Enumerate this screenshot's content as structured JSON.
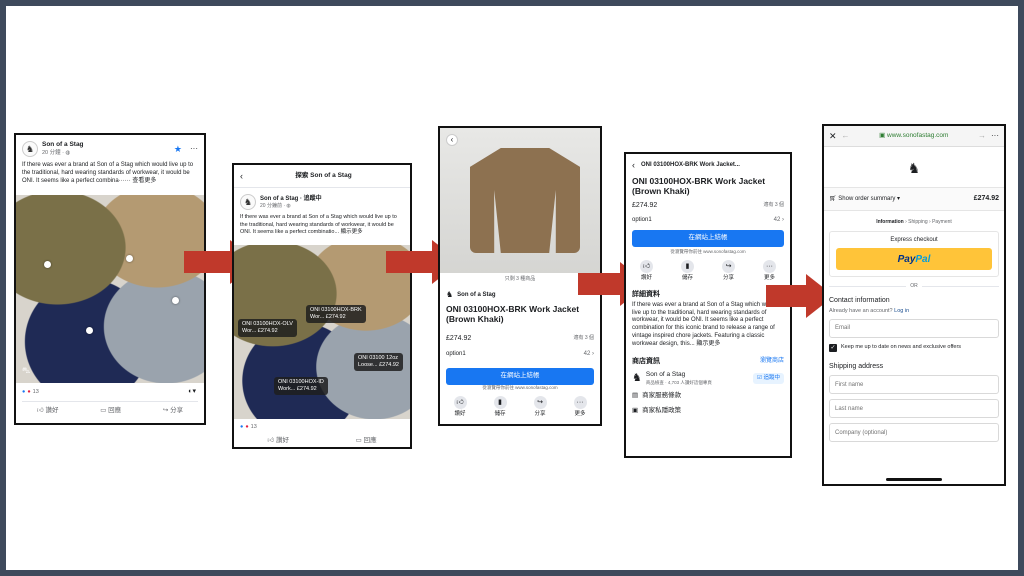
{
  "brand": "Son of a Stag",
  "post_text": "If there was ever a brand at Son of a Stag which would live up to the traditional, hard wearing standards of workwear, it would be ONI. It seems like a perfect combina······ 查看更多",
  "screen1": {
    "name": "Son of a Stag",
    "time": "20 分鐘 · ",
    "reaction_count": "13",
    "like": "讚好",
    "comment": "回應",
    "share": "分享"
  },
  "screen2": {
    "header": "探索 Son of a Stag",
    "name": "Son of a Stag · 追蹤中",
    "time": "20 分鐘前 · ",
    "text": "If there was ever a brand at Son of a Stag which would live up to the traditional, hard wearing standards of workwear, it would be ONI. It seems like a perfect combinatio... 顯示更多",
    "tags": [
      {
        "line1": "ONI 03100HOX-OLV",
        "line2": "Wor... £274.92"
      },
      {
        "line1": "ONI 03100HOX-BRK",
        "line2": "Wor... £274.92"
      },
      {
        "line1": "ONI 03100 12oz",
        "line2": "Loose... £274.92"
      },
      {
        "line1": "ONI 03100HOX-ID",
        "line2": "Work... £274.92"
      }
    ],
    "reaction_count": "13",
    "like": "讚好",
    "comment": "回應"
  },
  "screen3": {
    "caption": "只剩 3 種商品",
    "brand": "Son of a Stag",
    "title": "ONI 03100HOX-BRK Work Jacket (Brown Khaki)",
    "price": "£274.92",
    "shipping": "適有 3 個",
    "option": "option1",
    "option_count": "42",
    "cta": "在網站上結帳",
    "domain_note": "從瀏覽帶你前往 www.sonofastag.com",
    "actions": [
      "讚好",
      "儲存",
      "分享",
      "更多"
    ]
  },
  "screen4": {
    "header": "ONI 03100HOX-BRK Work Jacket...",
    "title": "ONI 03100HOX-BRK Work Jacket (Brown Khaki)",
    "price": "£274.92",
    "shipping": "適有 3 個",
    "option": "option1",
    "option_count": "42",
    "cta": "在網站上結帳",
    "domain_note": "從瀏覽帶你前往 www.sonofastag.com",
    "actions": [
      "讚好",
      "儲存",
      "分享",
      "更多"
    ],
    "details_heading": "詳細資料",
    "details": "If there was ever a brand at Son of a Stag which would live up to the traditional, hard wearing standards of workwear, it would be ONI. It seems like a perfect combination for this iconic brand to release a range of vintage inspired chore jackets. Featuring a classic workwear design, this... 顯示更多",
    "shop_heading": "商店資訊",
    "visit_shop": "瀏覽商店",
    "shop_name": "Son of a Stag",
    "shop_meta": "商品檢查 · 4,703 人讚好這個專頁",
    "follow": "追蹤中",
    "terms": "商家服務條款",
    "privacy": "商家私隱政策"
  },
  "screen5": {
    "url": "www.sonofastag.com",
    "order_summary": "Show order summary",
    "total": "£274.92",
    "breadcrumb": [
      "Information",
      "Shipping",
      "Payment"
    ],
    "express": "Express checkout",
    "paypal_1": "Pay",
    "paypal_2": "Pal",
    "or": "OR",
    "contact_heading": "Contact information",
    "have_account": "Already have an account? ",
    "login": "Log in",
    "email_placeholder": "Email",
    "keep_me": "Keep me up to date on news and exclusive offers",
    "shipping_heading": "Shipping address",
    "first_name": "First name",
    "last_name": "Last name",
    "company": "Company (optional)"
  }
}
